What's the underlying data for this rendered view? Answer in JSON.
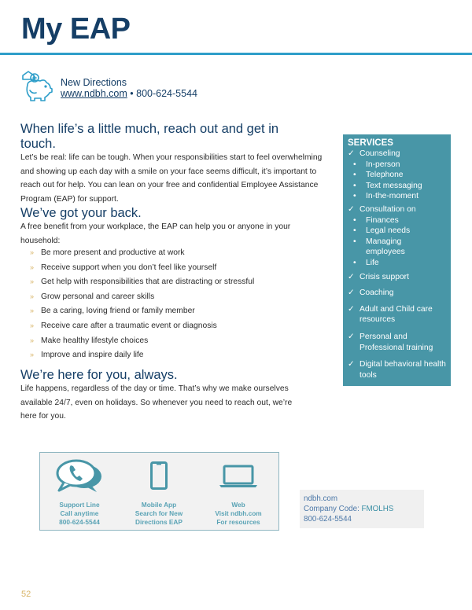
{
  "page": {
    "title": "My EAP",
    "page_number": "52"
  },
  "brand": {
    "icon": "piggy-bank-icon",
    "name": "New Directions",
    "website": "www.ndbh.com",
    "separator": "•",
    "phone": "800-624-5544"
  },
  "sections": [
    {
      "heading": "When life’s a little much, reach out and get in touch.",
      "body": "Let’s be real: life can be tough. When your responsibilities start to feel overwhelming and showing up each day with a smile on your face seems difficult, it’s important to reach out for help. You can lean on your free and confidential Employee Assistance Program (EAP) for support."
    },
    {
      "heading": "We’ve got your back.",
      "body": "A free benefit from your workplace, the EAP can help you or anyone in your household:",
      "bullet_marker": "»",
      "bullets": [
        "Be more present and productive at work",
        "Receive support when you don’t feel like yourself",
        "Get help with responsibilities that are distracting or stressful",
        "Grow personal and career skills",
        "Be a caring, loving friend or family member",
        "Receive care after a traumatic event or diagnosis",
        "Make healthy lifestyle choices",
        "Improve and inspire daily life"
      ]
    },
    {
      "heading": "We’re here for you, always.",
      "body": "Life happens, regardless of the day or time. That’s why we make ourselves available 24/7, even on holidays. So whenever you need to reach out, we’re here for you."
    }
  ],
  "services": {
    "title": "SERVICES",
    "check": "✓",
    "dot": "•",
    "items": [
      {
        "label": "Counseling",
        "sub": [
          "In-person",
          "Telephone",
          "Text messaging",
          "In-the-moment"
        ]
      },
      {
        "label": "Consultation on",
        "sub": [
          "Finances",
          "Legal needs",
          "Managing employees",
          "Life"
        ]
      },
      {
        "label": "Crisis support",
        "sub": []
      },
      {
        "label": "Coaching",
        "sub": []
      },
      {
        "label": "Adult and Child care resources",
        "sub": []
      },
      {
        "label": "Personal and Professional training",
        "sub": []
      },
      {
        "label": "Digital behavioral health tools",
        "sub": []
      }
    ],
    "bg_color": "#4896a7"
  },
  "contact_options": [
    {
      "icon": "phone-chat-icon",
      "lines": [
        "Support Line",
        "Call anytime",
        "800-624-5544"
      ]
    },
    {
      "icon": "mobile-phone-icon",
      "lines": [
        "Mobile App",
        "Search for New",
        "Directions EAP"
      ]
    },
    {
      "icon": "laptop-icon",
      "lines": [
        "Web",
        "Visit ndbh.com",
        "For resources"
      ]
    }
  ],
  "info_box": {
    "website": "ndbh.com",
    "company_code_label": "Company Code: ",
    "company_code": "FMOLHS",
    "phone": "800-624-5544"
  },
  "colors": {
    "navy": "#153e66",
    "accent_blue": "#2e9ec9",
    "teal": "#4896a7",
    "gold": "#d8b467"
  }
}
